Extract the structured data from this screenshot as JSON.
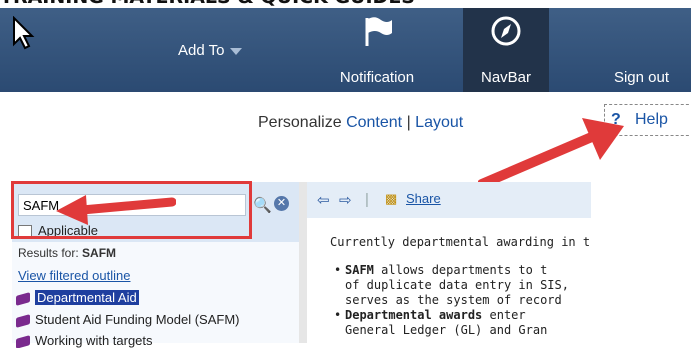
{
  "page_heading": "TRAINING MATERIALS & QUICK GUIDES",
  "topbar": {
    "add_to": "Add To",
    "notification": "Notification",
    "navbar": "NavBar",
    "sign_out": "Sign out"
  },
  "personalize": {
    "label": "Personalize",
    "content": "Content",
    "separator": "|",
    "layout": "Layout"
  },
  "help": {
    "icon": "?",
    "label": "Help"
  },
  "left_pane": {
    "search_value": "SAFM",
    "applicable_label": "Applicable",
    "results_prefix": "Results for:",
    "results_term": "SAFM",
    "view_filtered_outline": "View filtered outline",
    "tree": [
      {
        "label": "Departmental Aid",
        "selected": true
      },
      {
        "label": "Student Aid Funding Model (SAFM)",
        "selected": false
      },
      {
        "label": "Working with targets",
        "selected": false
      }
    ]
  },
  "right_pane": {
    "share_label": "Share",
    "intro": "Currently departmental awarding in t",
    "bullets": [
      {
        "bold": "SAFM",
        "text": " allows departments to t",
        "lines": [
          "of duplicate data entry in SIS,",
          "serves as the system of record"
        ]
      },
      {
        "bold": "Departmental awards",
        "text": " enter",
        "lines": [
          "General Ledger (GL) and Gran"
        ]
      }
    ]
  },
  "colors": {
    "topbar": "#2b4a72",
    "annotation_red": "#e03a3a",
    "link": "#1a55a6"
  },
  "icons": [
    "cursor-icon",
    "caret-down-icon",
    "flag-icon",
    "compass-icon",
    "search-icon",
    "clear-icon",
    "back-arrow-icon",
    "forward-arrow-icon",
    "share-icon",
    "book-icon"
  ]
}
